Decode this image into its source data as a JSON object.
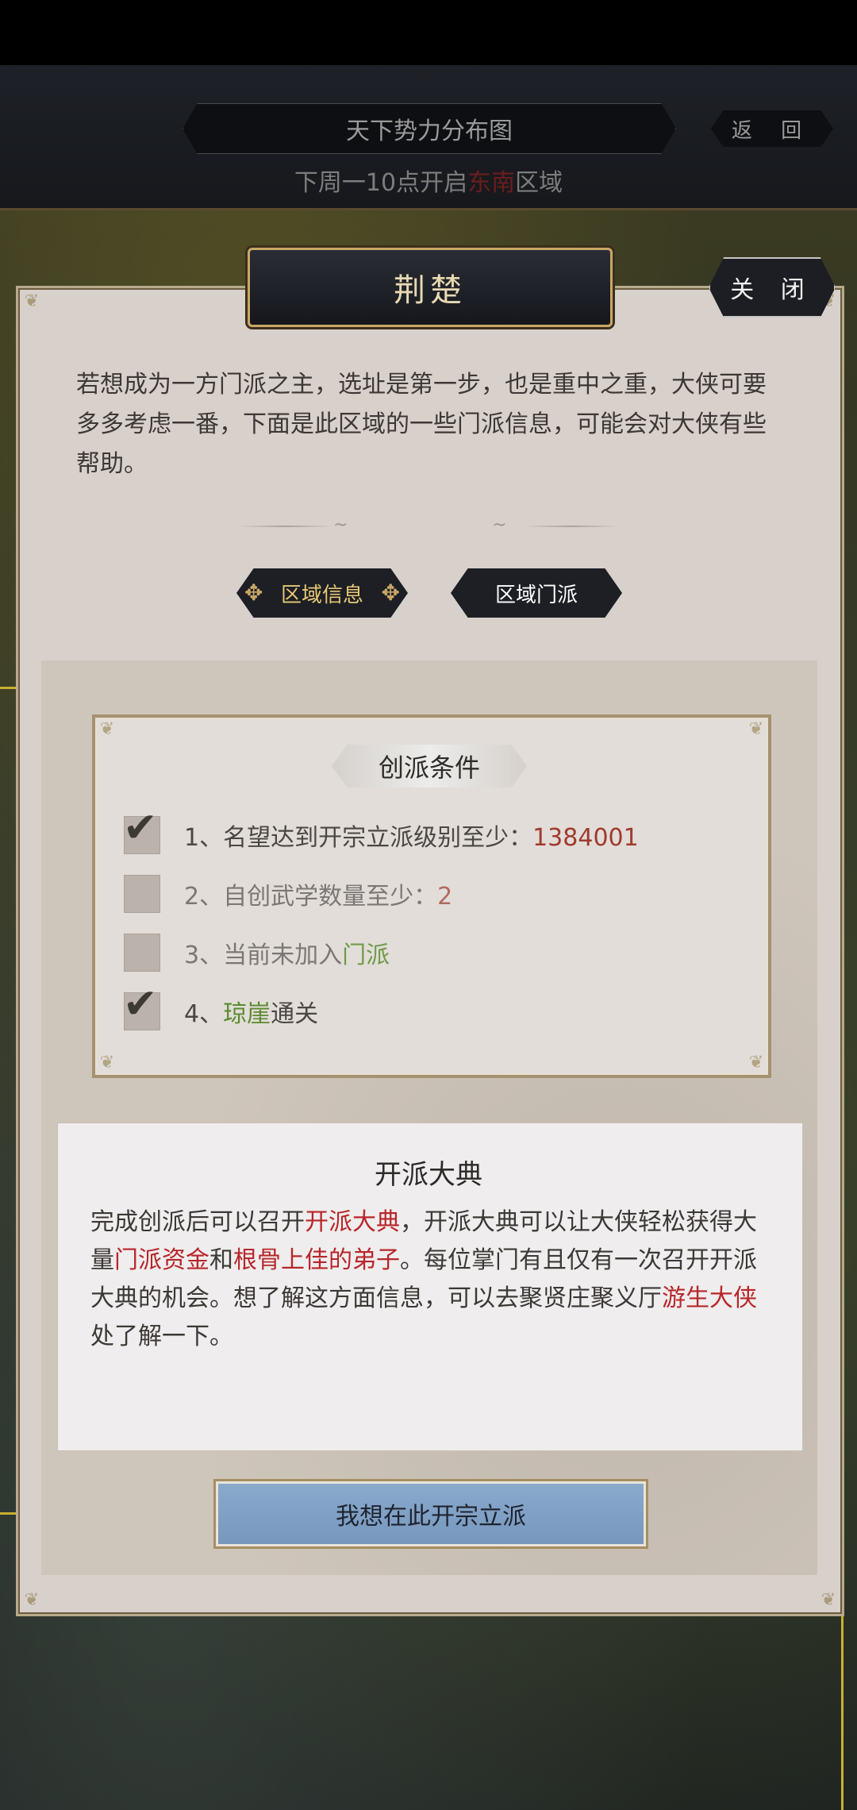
{
  "header": {
    "title": "天下势力分布图",
    "back_label": "返 回",
    "subtitle_before": "下周一10点开启",
    "subtitle_red": "东南",
    "subtitle_after": "区域"
  },
  "dialog": {
    "title": "荆楚",
    "close_label": "关 闭",
    "intro": "若想成为一方门派之主，选址是第一步，也是重中之重，大侠可要多多考虑一番，下面是此区域的一些门派信息，可能会对大侠有些帮助。",
    "tabs": [
      {
        "label": "区域信息",
        "active": true
      },
      {
        "label": "区域门派",
        "active": false
      }
    ]
  },
  "conditions": {
    "title": "创派条件",
    "items": [
      {
        "prefix": "1、名望达到开宗立派级别至少：",
        "value": "1384001",
        "checked": true
      },
      {
        "prefix": "2、自创武学数量至少：",
        "value": "2",
        "checked": false
      },
      {
        "prefix": "3、当前未加入",
        "value": "门派",
        "checked": false
      },
      {
        "prefix": "4、",
        "value": "琼崖",
        "suffix": "通关",
        "checked": true
      }
    ]
  },
  "ceremony": {
    "title": "开派大典",
    "p1": "完成创派后可以召开",
    "h1": "开派大典",
    "p2": "，开派大典可以让大侠轻松获得大量",
    "h2": "门派资金",
    "p3": "和",
    "h3": "根骨上佳的弟子",
    "p4": "。每位掌门有且仅有一次召开开派大典的机会。想了解这方面信息，可以去聚贤庄聚义厅",
    "h4": "游生大侠",
    "p5": "处了解一下。"
  },
  "found_button": "我想在此开宗立派",
  "colors": {
    "accent_gold": "#c9a866",
    "highlight_red": "#b8262a",
    "highlight_green": "#5b8a2e",
    "button_blue": "#7f9fc6"
  }
}
